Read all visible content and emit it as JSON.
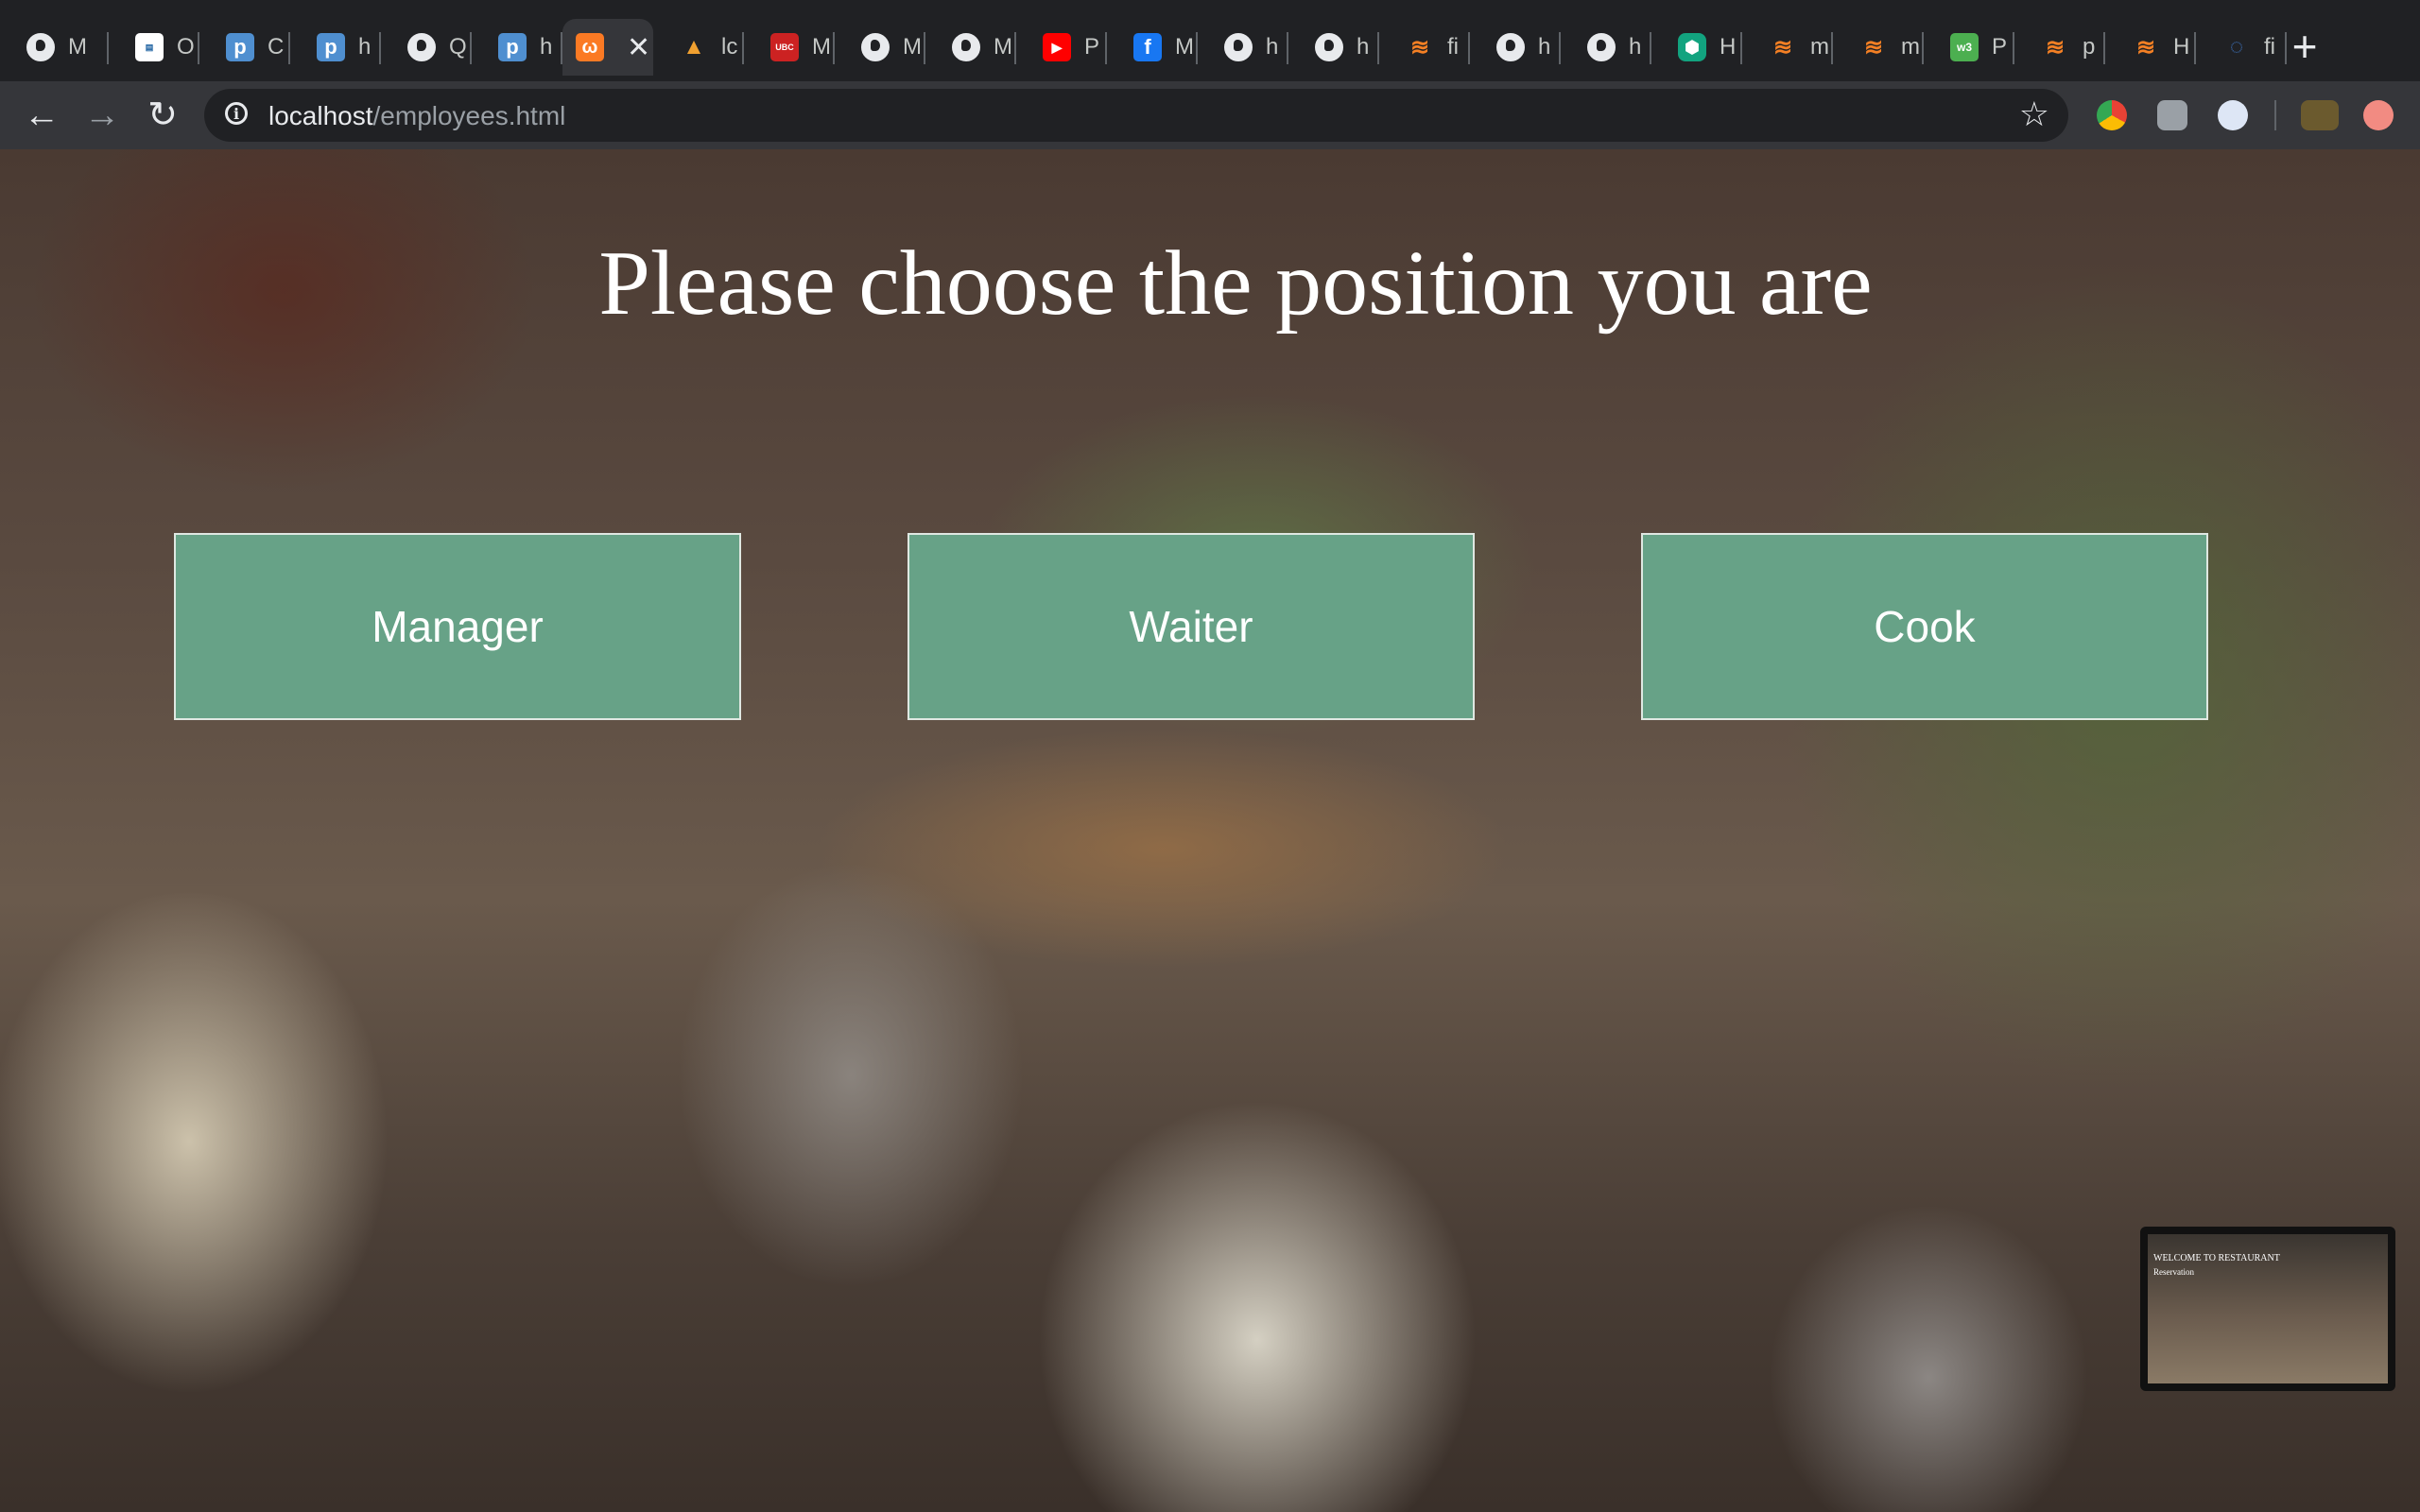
{
  "browser": {
    "tabs": [
      {
        "label": "M",
        "icon": "globe-icon"
      },
      {
        "label": "O",
        "icon": "site-logo-icon"
      },
      {
        "label": "C",
        "icon": "p-logo-icon"
      },
      {
        "label": "h",
        "icon": "p-logo-icon"
      },
      {
        "label": "Q",
        "icon": "globe-icon"
      },
      {
        "label": "h",
        "icon": "p-logo-icon"
      },
      {
        "label": "",
        "icon": "xampp-icon",
        "active": true
      },
      {
        "label": "lc",
        "icon": "pma-icon"
      },
      {
        "label": "M",
        "icon": "ubc-canvas-icon"
      },
      {
        "label": "M",
        "icon": "globe-icon"
      },
      {
        "label": "M",
        "icon": "globe-icon"
      },
      {
        "label": "P",
        "icon": "youtube-icon"
      },
      {
        "label": "M",
        "icon": "facebook-icon"
      },
      {
        "label": "h",
        "icon": "globe-icon"
      },
      {
        "label": "h",
        "icon": "globe-icon"
      },
      {
        "label": "fi",
        "icon": "stackoverflow-icon"
      },
      {
        "label": "h",
        "icon": "globe-icon"
      },
      {
        "label": "h",
        "icon": "globe-icon"
      },
      {
        "label": "H",
        "icon": "hex-logo-icon"
      },
      {
        "label": "m",
        "icon": "stackoverflow-icon"
      },
      {
        "label": "m",
        "icon": "stackoverflow-icon"
      },
      {
        "label": "P",
        "icon": "w3-icon"
      },
      {
        "label": "p",
        "icon": "stackoverflow-icon"
      },
      {
        "label": "H",
        "icon": "stackoverflow-icon"
      },
      {
        "label": "fi",
        "icon": "css-icon"
      }
    ],
    "close_glyph": "✕",
    "new_tab_glyph": "+",
    "nav": {
      "back": "←",
      "forward": "→",
      "reload": "↻"
    },
    "url": {
      "host": "localhost",
      "path": "/employees.html"
    },
    "star_glyph": "☆"
  },
  "page": {
    "title": "Please choose the position you are",
    "buttons": [
      {
        "label": "Manager"
      },
      {
        "label": "Waiter"
      },
      {
        "label": "Cook"
      }
    ],
    "thumbnail": {
      "heading": "WELCOME TO RESTAURANT",
      "subheading": "Reservation"
    }
  },
  "colors": {
    "button_bg": "#67a287",
    "tab_bg": "#202124",
    "toolbar_bg": "#35363a"
  }
}
